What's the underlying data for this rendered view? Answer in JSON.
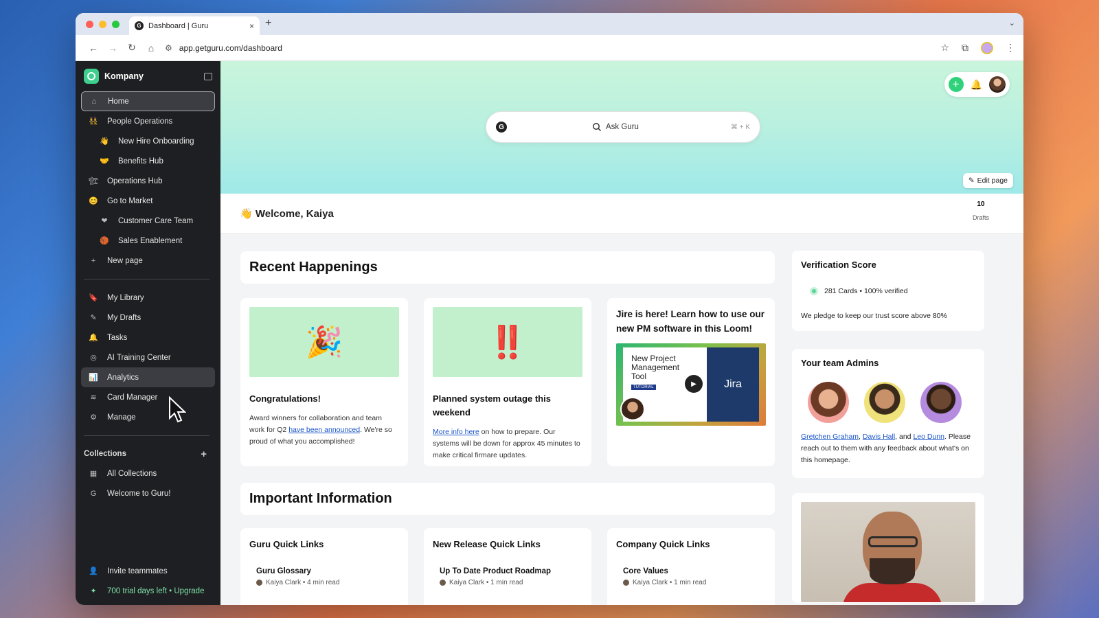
{
  "browser": {
    "tab_title": "Dashboard | Guru",
    "url": "app.getguru.com/dashboard",
    "colors": {
      "close": "#ff5f57",
      "minimize": "#febc2e",
      "maximize": "#28c840"
    }
  },
  "sidebar": {
    "workspace": "Kompany",
    "pages": [
      {
        "label": "Home",
        "icon": "home-icon",
        "glyph": "⌂"
      },
      {
        "label": "People Operations",
        "icon": "people-icon",
        "glyph": "👯"
      },
      {
        "label": "New Hire Onboarding",
        "icon": "wave-icon",
        "glyph": "👋"
      },
      {
        "label": "Benefits Hub",
        "icon": "handshake-icon",
        "glyph": "🤝"
      },
      {
        "label": "Operations Hub",
        "icon": "construction-icon",
        "glyph": "🏗"
      },
      {
        "label": "Go to Market",
        "icon": "smile-icon",
        "glyph": "😊"
      },
      {
        "label": "Customer Care Team",
        "icon": "heart-icon",
        "glyph": "❤"
      },
      {
        "label": "Sales Enablement",
        "icon": "basketball-icon",
        "glyph": "🏀"
      },
      {
        "label": "New page",
        "icon": "plus-icon",
        "glyph": "+"
      }
    ],
    "tools": [
      {
        "label": "My Library",
        "icon": "bookmark-icon",
        "glyph": "🔖"
      },
      {
        "label": "My Drafts",
        "icon": "edit-icon",
        "glyph": "✎"
      },
      {
        "label": "Tasks",
        "icon": "bell-icon",
        "glyph": "🔔"
      },
      {
        "label": "AI Training Center",
        "icon": "ai-icon",
        "glyph": "◎"
      },
      {
        "label": "Analytics",
        "icon": "bar-chart-icon",
        "glyph": "📊"
      },
      {
        "label": "Card Manager",
        "icon": "layers-icon",
        "glyph": "≋"
      },
      {
        "label": "Manage",
        "icon": "gear-icon",
        "glyph": "⚙"
      }
    ],
    "collections_label": "Collections",
    "collections": [
      {
        "label": "All Collections",
        "icon": "grid-icon",
        "glyph": "▦"
      },
      {
        "label": "Welcome to Guru!",
        "icon": "guru-icon",
        "glyph": "G"
      }
    ],
    "invite": "Invite teammates",
    "trial": "700 trial days left • Upgrade"
  },
  "hero": {
    "search_placeholder": "Ask Guru",
    "shortcut": "⌘ + K",
    "edit_page": "Edit page"
  },
  "welcome": {
    "text": "👋 Welcome, Kaiya",
    "drafts_count": "10",
    "drafts_label": "Drafts"
  },
  "recent": {
    "title": "Recent Happenings",
    "cards": [
      {
        "emoji": "🎉",
        "title": "Congratulations!",
        "body_before": "Award winners for collaboration and team work for Q2 ",
        "link": "have been announced",
        "body_after": ".  We're so proud of what you accomplished!"
      },
      {
        "emoji": "‼️",
        "title": "Planned system outage this weekend",
        "link": "More info here",
        "body_after": " on how to prepare. Our systems will be down for approx 45 minutes to make critical firmare updates."
      },
      {
        "title": "Jire is here! Learn how to use our new PM software in this Loom!",
        "video_title": "New Project Management Tool",
        "video_tag": "TUTORIAL",
        "video_brand": "Jira"
      }
    ]
  },
  "verification": {
    "title": "Verification Score",
    "stat": "281 Cards • 100% verified",
    "pledge": "We pledge to keep our trust score above 80%"
  },
  "admins": {
    "title": "Your team Admins",
    "names": [
      "Gretchen Graham",
      "Davis Hall",
      "Leo Dunn"
    ],
    "sep1": ", ",
    "sep2": ", and ",
    "tail": ". Please reach out to them with any feedback about what's on this homepage."
  },
  "important": {
    "title": "Important Information",
    "lists": [
      {
        "title": "Guru Quick Links",
        "item": "Guru Glossary",
        "meta": "Kaiya Clark • 4 min read"
      },
      {
        "title": "New Release Quick Links",
        "item": "Up To Date Product Roadmap",
        "meta": "Kaiya Clark • 1 min read"
      },
      {
        "title": "Company Quick Links",
        "item": "Core Values",
        "meta": "Kaiya Clark • 1 min read"
      }
    ]
  }
}
